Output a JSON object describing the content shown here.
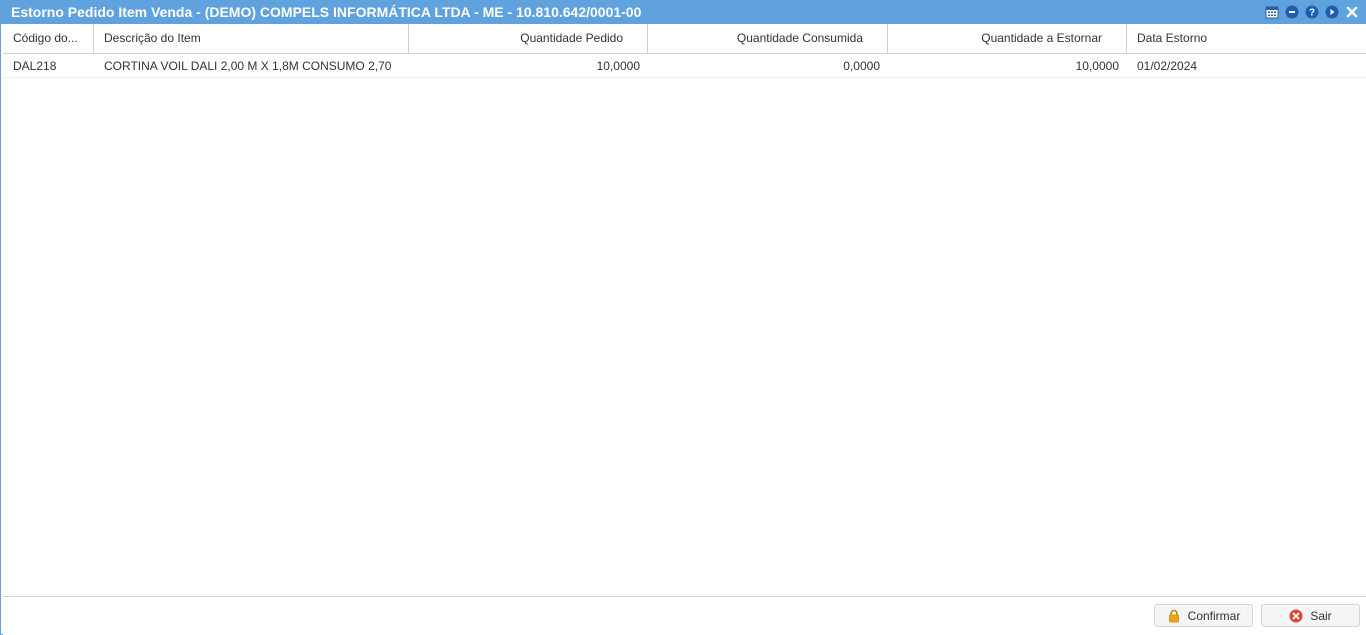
{
  "window": {
    "title": "Estorno Pedido Item Venda - (DEMO) COMPELS INFORMÁTICA LTDA - ME - 10.810.642/0001-00",
    "tools": [
      "calendar-icon",
      "minimize-icon",
      "help-icon",
      "forward-icon",
      "close-icon"
    ]
  },
  "grid": {
    "columns": [
      "Código do...",
      "Descrição do Item",
      "Quantidade Pedido",
      "Quantidade Consumida",
      "Quantidade a Estornar",
      "Data Estorno"
    ],
    "rows": [
      {
        "codigo": "DAL218",
        "descricao": "CORTINA VOIL DALI 2,00 M X 1,8M CONSUMO 2,70",
        "qtd_pedido": "10,0000",
        "qtd_consumida": "0,0000",
        "qtd_estornar": "10,0000",
        "data_estorno": "01/02/2024"
      }
    ]
  },
  "footer": {
    "confirm_label": "Confirmar",
    "exit_label": "Sair"
  },
  "colors": {
    "titlebar": "#5fa2dd",
    "confirm_icon": "#f0a30a",
    "exit_icon": "#e0433a"
  }
}
